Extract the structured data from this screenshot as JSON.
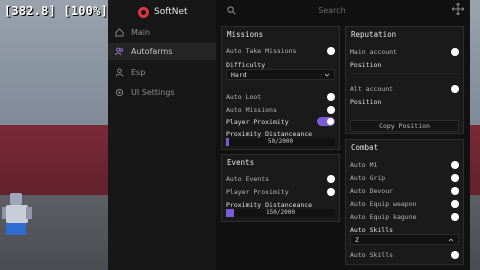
{
  "overlay": {
    "fps_text": "[382.8] [100%]"
  },
  "brand": {
    "name": "SoftNet",
    "accent": "#e0353f",
    "toggle_on": "#7b5cd4"
  },
  "sidebar": {
    "items": [
      {
        "label": "Main",
        "icon": "home-icon",
        "active": false
      },
      {
        "label": "Autofarms",
        "icon": "users-icon",
        "active": true
      },
      {
        "label": "Esp",
        "icon": "user-icon",
        "active": false
      },
      {
        "label": "UI Settings",
        "icon": "settings-icon",
        "active": false
      }
    ]
  },
  "search": {
    "placeholder": "Search"
  },
  "missions": {
    "title": "Missions",
    "auto_take_missions": "Auto Take Missions",
    "difficulty_label": "Difficulty",
    "difficulty_value": "Hard",
    "auto_loot": "Auto Loot",
    "auto_missions": "Auto Missions",
    "player_proximity": "Player Proximity",
    "player_proximity_enabled": true,
    "proximity_label": "Proximity Distanceance",
    "proximity_value": "50/2000",
    "proximity_fraction": 0.025
  },
  "events": {
    "title": "Events",
    "auto_events": "Auto Events",
    "player_proximity": "Player Proximity",
    "proximity_label": "Proximity Distanceance",
    "proximity_value": "150/2000",
    "proximity_fraction": 0.075
  },
  "reputation": {
    "title": "Reputation",
    "main_account": "Main account",
    "position_1": "Position",
    "alt_account": "Alt account",
    "position_2": "Position",
    "copy_position": "Copy Position"
  },
  "combat": {
    "title": "Combat",
    "auto_m1": "Auto M1",
    "auto_grip": "Auto Grip",
    "auto_devour": "Auto Devour",
    "auto_equip_weapon": "Auto Equip weapon",
    "auto_equip_kagune": "Auto Equip kagune",
    "auto_skills_label": "Auto Skills",
    "auto_skills_value": "Z",
    "auto_skills_toggle": "Auto Skills"
  }
}
